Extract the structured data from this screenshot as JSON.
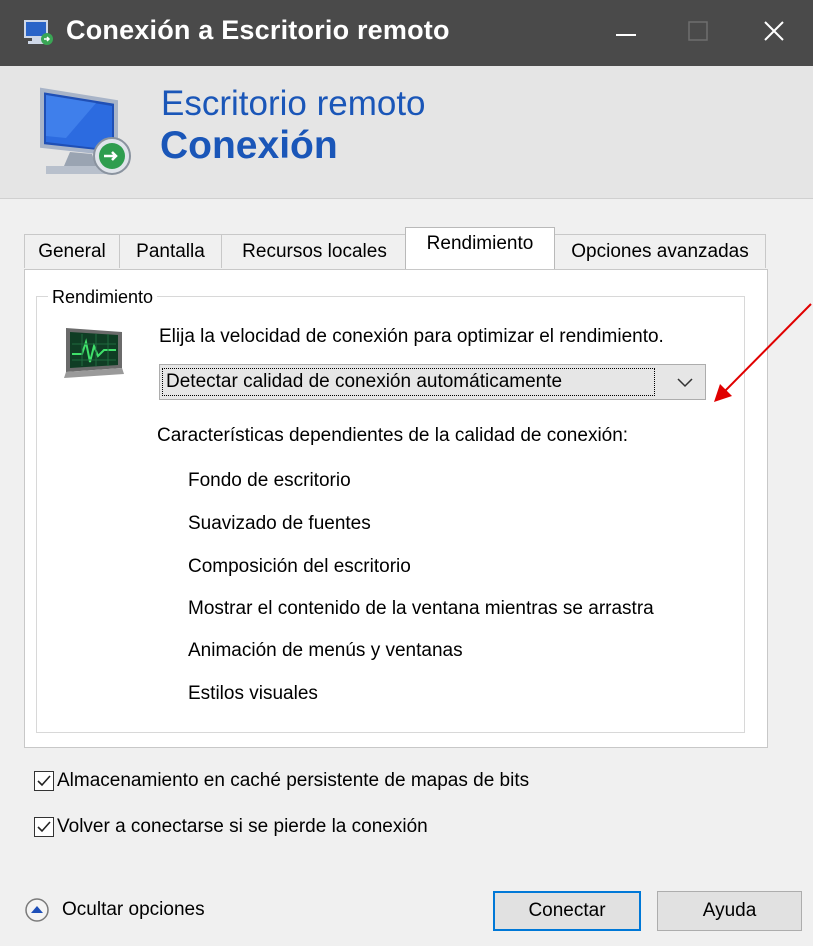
{
  "window": {
    "title": "Conexión a Escritorio remoto",
    "accent_color": "#0078d7",
    "titlebar_color": "#4a4a4a"
  },
  "banner": {
    "line1": "Escritorio remoto",
    "line2": "Conexión",
    "text_color": "#1a56b8"
  },
  "tabs": [
    {
      "label": "General",
      "active": false
    },
    {
      "label": "Pantalla",
      "active": false
    },
    {
      "label": "Recursos locales",
      "active": false
    },
    {
      "label": "Rendimiento",
      "active": true
    },
    {
      "label": "Opciones avanzadas",
      "active": false
    }
  ],
  "performance": {
    "group_label": "Rendimiento",
    "prompt": "Elija la velocidad de conexión para optimizar el rendimiento.",
    "connection_select": {
      "selected": "Detectar calidad de conexión automáticamente"
    },
    "features_title": "Características dependientes de la calidad de conexión:",
    "features": [
      "Fondo de escritorio",
      "Suavizado de fuentes",
      "Composición del escritorio",
      "Mostrar el contenido de la ventana mientras se arrastra",
      "Animación de menús y ventanas",
      "Estilos visuales"
    ]
  },
  "options": [
    {
      "label": "Almacenamiento en caché persistente de mapas de bits",
      "checked": true
    },
    {
      "label": "Volver a conectarse si se pierde la conexión",
      "checked": true
    }
  ],
  "footer": {
    "hide_options_label": "Ocultar opciones",
    "connect_label": "Conectar",
    "help_label": "Ayuda"
  },
  "annotation": {
    "arrow_color": "#e00000"
  }
}
